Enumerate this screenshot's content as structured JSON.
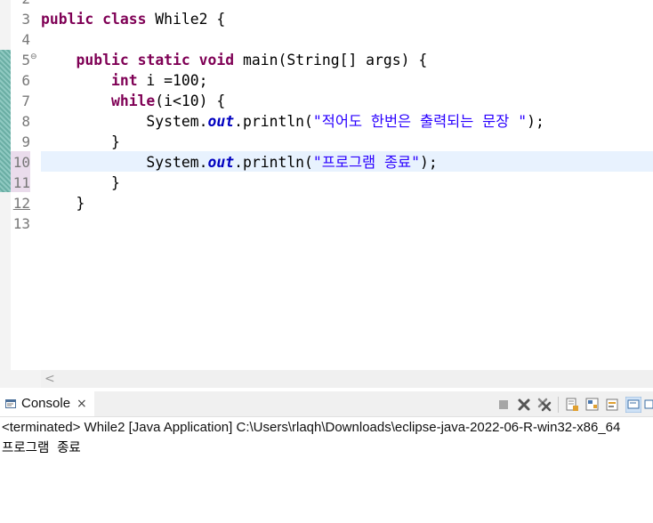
{
  "editor": {
    "line_numbers": [
      "2",
      "3",
      "4",
      "5",
      "6",
      "7",
      "8",
      "9",
      "10",
      "11",
      "12",
      "13"
    ],
    "lines": [
      [],
      [
        {
          "t": "public",
          "c": "kw"
        },
        {
          "t": " "
        },
        {
          "t": "class",
          "c": "kw"
        },
        {
          "t": " While2 {"
        }
      ],
      [],
      [
        {
          "t": "    "
        },
        {
          "t": "public",
          "c": "kw"
        },
        {
          "t": " "
        },
        {
          "t": "static",
          "c": "kw"
        },
        {
          "t": " "
        },
        {
          "t": "void",
          "c": "kw"
        },
        {
          "t": " main(String[] args) {"
        }
      ],
      [
        {
          "t": "        "
        },
        {
          "t": "int",
          "c": "kw"
        },
        {
          "t": " i =100;"
        }
      ],
      [
        {
          "t": "        "
        },
        {
          "t": "while",
          "c": "kw"
        },
        {
          "t": "(i<10) {"
        }
      ],
      [
        {
          "t": "            System."
        },
        {
          "t": "out",
          "c": "fld"
        },
        {
          "t": ".println("
        },
        {
          "t": "\"적어도 한번은 출력되는 문장 \"",
          "c": "str"
        },
        {
          "t": ");"
        }
      ],
      [
        {
          "t": "        }"
        }
      ],
      [
        {
          "t": "            System."
        },
        {
          "t": "out",
          "c": "fld"
        },
        {
          "t": ".println("
        },
        {
          "t": "\"프로그램 종료\"",
          "c": "str"
        },
        {
          "t": ");"
        }
      ],
      [
        {
          "t": "        }"
        }
      ],
      [
        {
          "t": "    }"
        }
      ],
      []
    ]
  },
  "console": {
    "tab_label": "Console",
    "close_glyph": "×",
    "status": "<terminated> While2 [Java Application] C:\\Users\\rlaqh\\Downloads\\eclipse-java-2022-06-R-win32-x86_64",
    "output": "프로그램 종료",
    "toolbar": [
      "terminate-icon",
      "remove-launch-icon",
      "remove-all-terminated-icon",
      "scroll-lock-icon",
      "word-wrap-icon",
      "show-on-output-icon",
      "pin-console-icon",
      "display-selected-console-icon"
    ]
  },
  "colors": {
    "keyword": "#7f0055",
    "string": "#2a00ff",
    "field": "#0000c0",
    "current_line": "#e8f2fe",
    "change_bar": "#8fc9c1"
  }
}
